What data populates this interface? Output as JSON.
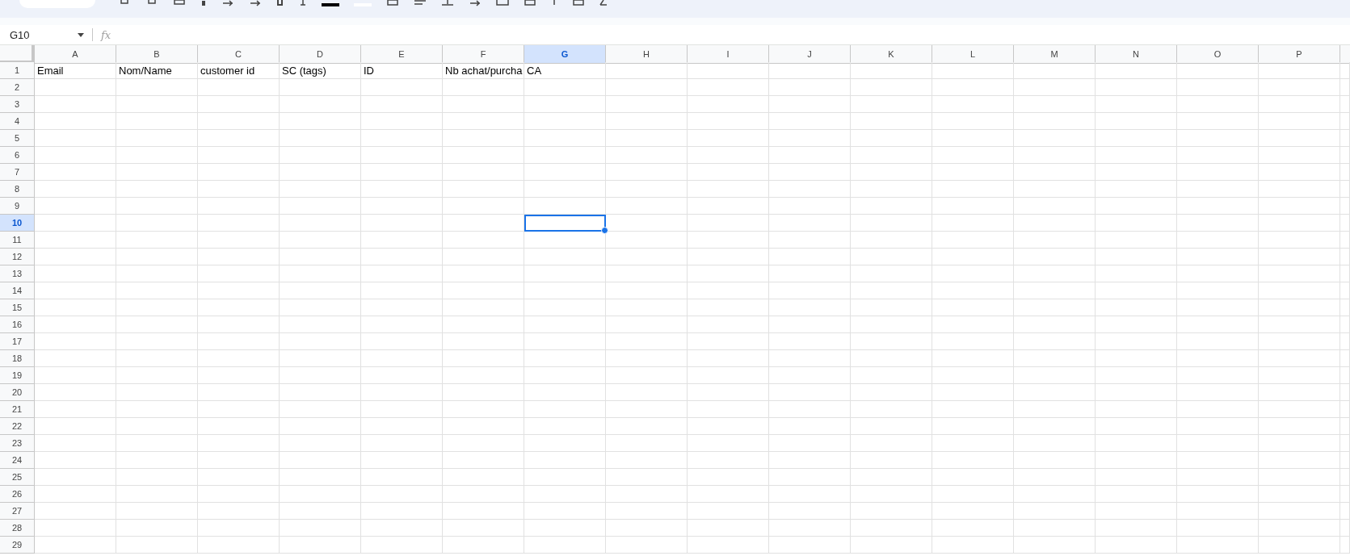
{
  "name_box": {
    "value": "G10"
  },
  "formula_bar": {
    "icon": "fx"
  },
  "columns": [
    {
      "label": "A",
      "selected": false
    },
    {
      "label": "B",
      "selected": false
    },
    {
      "label": "C",
      "selected": false
    },
    {
      "label": "D",
      "selected": false
    },
    {
      "label": "E",
      "selected": false
    },
    {
      "label": "F",
      "selected": false
    },
    {
      "label": "G",
      "selected": true
    },
    {
      "label": "H",
      "selected": false
    },
    {
      "label": "I",
      "selected": false
    },
    {
      "label": "J",
      "selected": false
    },
    {
      "label": "K",
      "selected": false
    },
    {
      "label": "L",
      "selected": false
    },
    {
      "label": "M",
      "selected": false
    },
    {
      "label": "N",
      "selected": false
    },
    {
      "label": "O",
      "selected": false
    },
    {
      "label": "P",
      "selected": false
    }
  ],
  "rows": [
    {
      "label": "1",
      "selected": false,
      "cells": [
        "Email",
        "Nom/Name",
        "customer id",
        "SC (tags)",
        "ID",
        "Nb achat/purcha",
        "CA"
      ]
    },
    {
      "label": "2",
      "selected": false
    },
    {
      "label": "3",
      "selected": false
    },
    {
      "label": "4",
      "selected": false
    },
    {
      "label": "5",
      "selected": false
    },
    {
      "label": "6",
      "selected": false
    },
    {
      "label": "7",
      "selected": false
    },
    {
      "label": "8",
      "selected": false
    },
    {
      "label": "9",
      "selected": false
    },
    {
      "label": "10",
      "selected": true
    },
    {
      "label": "11",
      "selected": false
    },
    {
      "label": "12",
      "selected": false
    },
    {
      "label": "13",
      "selected": false
    },
    {
      "label": "14",
      "selected": false
    },
    {
      "label": "15",
      "selected": false
    },
    {
      "label": "16",
      "selected": false
    },
    {
      "label": "17",
      "selected": false
    },
    {
      "label": "18",
      "selected": false
    },
    {
      "label": "19",
      "selected": false
    },
    {
      "label": "20",
      "selected": false
    },
    {
      "label": "21",
      "selected": false
    },
    {
      "label": "22",
      "selected": false
    },
    {
      "label": "23",
      "selected": false
    },
    {
      "label": "24",
      "selected": false
    },
    {
      "label": "25",
      "selected": false
    },
    {
      "label": "26",
      "selected": false
    },
    {
      "label": "27",
      "selected": false
    },
    {
      "label": "28",
      "selected": false
    },
    {
      "label": "29",
      "selected": false
    }
  ]
}
